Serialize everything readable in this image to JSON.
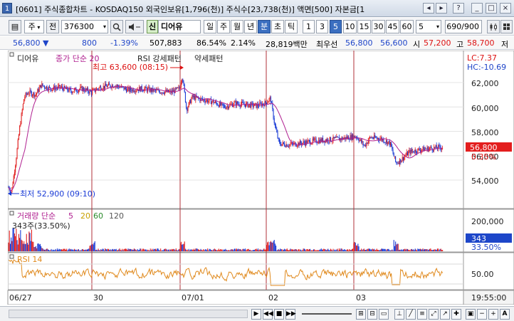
{
  "window": {
    "number": "1",
    "title": "[0601] 주식종합차트 - KOSDAQ150 외국인보유[1,796(천)] 주식수[23,738(천)] 액면[500] 자본금[1",
    "buttons": [
      "◂",
      "▸",
      "?",
      "_",
      "□",
      "×"
    ]
  },
  "toolbar": {
    "icon_btn": "▤",
    "market": "주",
    "prev": "전",
    "code": "376300",
    "name_badge": "신",
    "name": "디어유",
    "periods": [
      "일",
      "주",
      "월",
      "년",
      "분",
      "초",
      "틱"
    ],
    "active_period": "분",
    "intervals": [
      "1",
      "3",
      "5",
      "10",
      "15",
      "30",
      "45",
      "60"
    ],
    "active_interval": "5",
    "interval_value": "5",
    "count": "690",
    "count_total": "/900"
  },
  "quote": {
    "price": "56,800 ▼",
    "change": "800",
    "change_pct": "-1.39%",
    "volume": "507,883",
    "vol_pct": "86.54%",
    "vol_ratio": "2.14%",
    "amount": "28,819백만",
    "priority_label": "최우선",
    "ask": "56,800",
    "bid": "56,600",
    "open_label": "시",
    "open": "57,200",
    "high_label": "고",
    "high": "58,700",
    "low_label": "저"
  },
  "chart": {
    "name": "디어유",
    "price_legend": "종가 단순 20",
    "rsi_pattern": "RSI 강세패턴",
    "rsi_weak": "약세패턴",
    "lc": "LC:7.37",
    "hc": "HC:-10.69",
    "high_label": "최고 63,600 (08:15)",
    "low_label": "최저 52,900 (09:10)",
    "price_ticks": [
      "62,000",
      "60,000",
      "58,000",
      "56,000",
      "54,000"
    ],
    "price_tag": "56,800",
    "pct_tag": "0.35%",
    "volume_legend": "거래량 단순",
    "volume_periods": [
      "5",
      "20",
      "60",
      "120"
    ],
    "volume_sub": "343주(33.50%)",
    "volume_tick": "200,000",
    "volume_tag": "343",
    "volume_pct_tag": "33.50%",
    "rsi_legend": "RSI 14",
    "rsi_tick": "50.00",
    "dates": [
      "06/27",
      "30",
      "07/01",
      "02",
      "03"
    ],
    "time_label": "19:55:00",
    "colors": {
      "candle_up": "#e02020",
      "candle_down": "#1a3bd6",
      "ma20": "#b02090",
      "rsi": "#e08a1e",
      "vline": "#b0303a",
      "price_tag_bg": "#e31e1e",
      "volume_tag_bg": "#1d46c9"
    }
  }
}
